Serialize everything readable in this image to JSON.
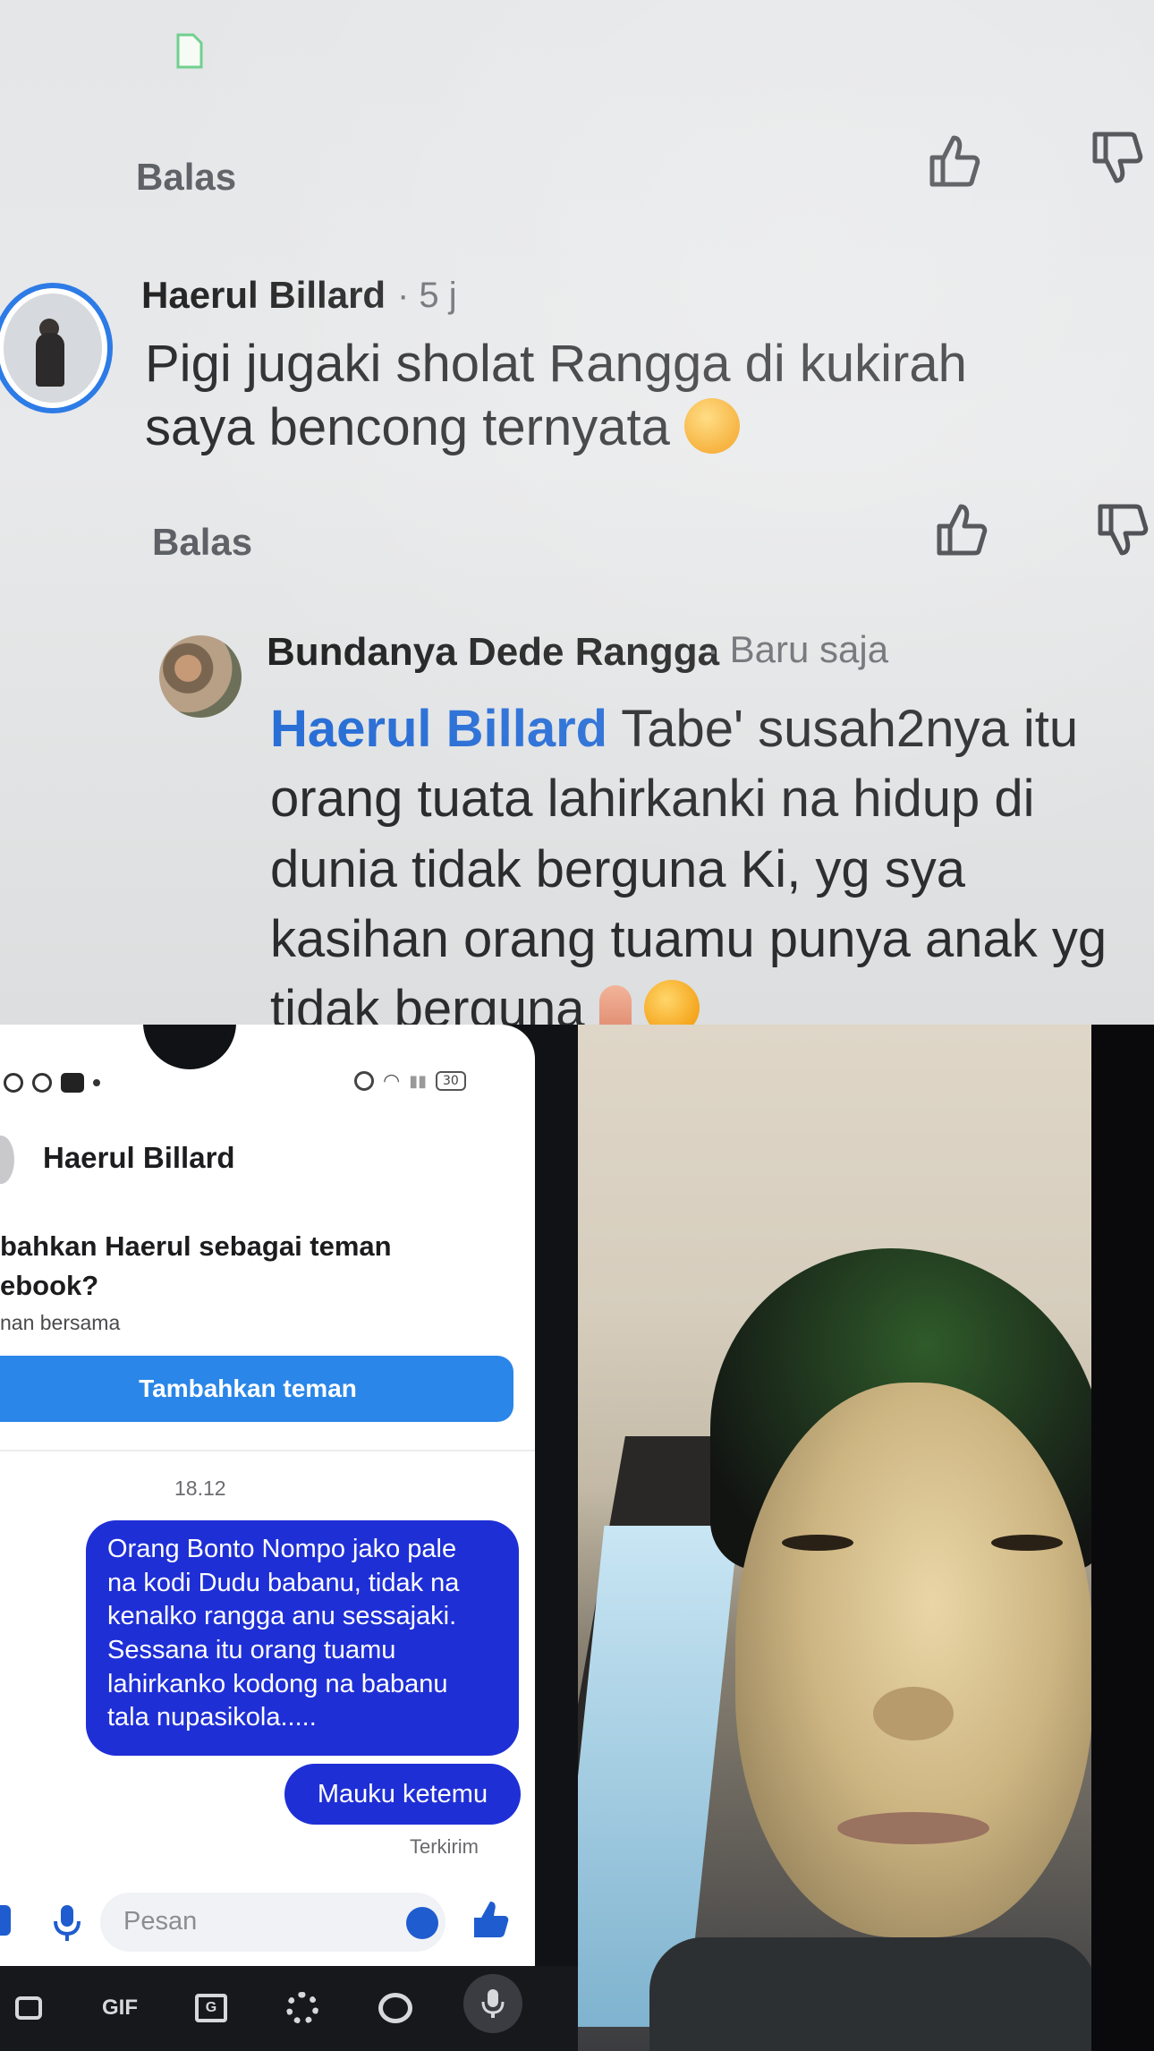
{
  "comments_panel": {
    "reply_label": "Balas",
    "comment1": {
      "author": "Haerul Billard",
      "time": "· 5 j",
      "line1": "Pigi jugaki sholat Rangga di kukirah",
      "line2": "saya bencong ternyata"
    },
    "comment2": {
      "author": "Bundanya Dede Rangga",
      "time": "· Baru saja",
      "mention": "Haerul Billard",
      "line1": "Tabe' susah2nya itu",
      "line2": "orang tuata lahirkanki na hidup di",
      "line3": "dunia tidak berguna Ki, yg sya",
      "line4": "kasihan orang tuamu punya anak yg",
      "line5": "tidak berguna"
    }
  },
  "messenger": {
    "contact_name": "Haerul Billard",
    "add_friend_title_line1": "bahkan Haerul sebagai teman",
    "add_friend_title_line2": "ebook?",
    "mutual": "nan bersama",
    "close_glyph": "×",
    "add_friend_button": "Tambahkan teman",
    "timestamp": "18.12",
    "messages": [
      "Orang Bonto Nompo jako pale\nna kodi Dudu babanu, tidak na\nkenalko rangga anu sessajaki.\nSessana itu orang tuamu\nlahirkanko kodong na babanu\ntala nupasikola.....",
      "Mauku ketemu"
    ],
    "status": "Terkirim",
    "input_placeholder": "Pesan",
    "battery": "30",
    "colors": {
      "bubble": "#1f2fd6",
      "button": "#2a86e8"
    }
  },
  "keyboard": {
    "gif_label": "GIF",
    "translate_label": "G"
  }
}
